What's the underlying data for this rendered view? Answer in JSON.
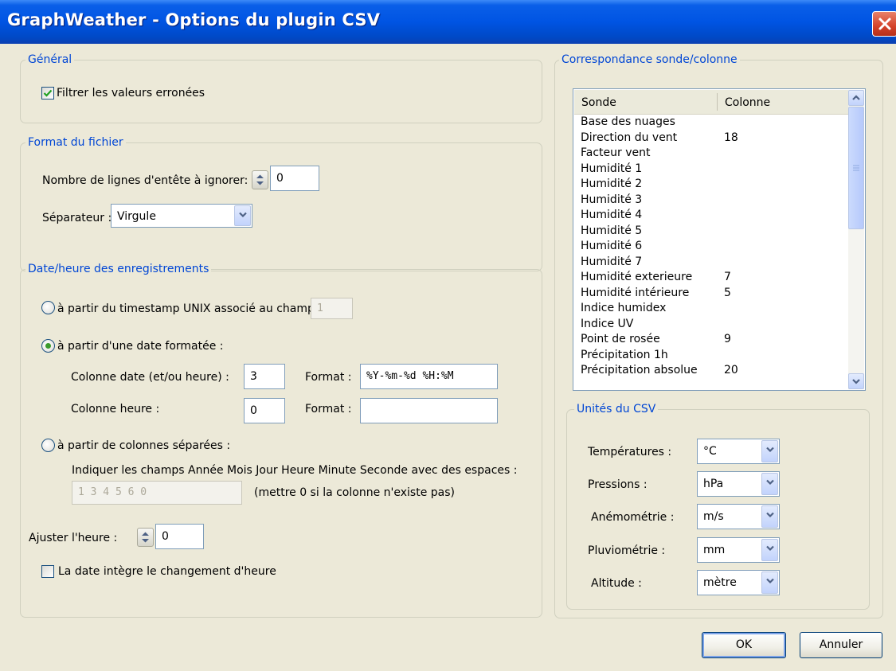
{
  "window": {
    "title": "GraphWeather - Options du plugin CSV"
  },
  "general": {
    "legend": "Général",
    "filter_label": "Filtrer les valeurs erronées",
    "filter_checked": true
  },
  "format": {
    "legend": "Format du fichier",
    "header_lines_label": "Nombre de lignes d'entête à ignorer:",
    "header_lines_value": "0",
    "separator_label": "Séparateur :",
    "separator_value": "Virgule"
  },
  "datetime": {
    "legend": "Date/heure des enregistrements",
    "option_unix_label": "à partir du timestamp UNIX associé au champ :",
    "option_unix_value": "1",
    "option_formatted_label": "à partir d'une date formatée :",
    "date_column_label": "Colonne date (et/ou heure) :",
    "date_column_value": "3",
    "format_label": "Format :",
    "date_format_value": "%Y-%m-%d %H:%M",
    "time_column_label": "Colonne heure :",
    "time_column_value": "0",
    "time_format_label": "Format :",
    "time_format_value": "",
    "option_separate_label": "à partir de colonnes séparées :",
    "separate_hint": "Indiquer les champs Année Mois Jour Heure Minute Seconde avec des espaces :",
    "separate_value": "1 3 4 5 6 0",
    "separate_note": "(mettre 0 si la colonne n'existe pas)",
    "selected_option": "formatted",
    "adjust_label": "Ajuster l'heure :",
    "adjust_value": "0",
    "dst_label": "La date intègre le changement d'heure",
    "dst_checked": false
  },
  "mapping": {
    "legend": "Correspondance sonde/colonne",
    "col_sensor": "Sonde",
    "col_column": "Colonne",
    "rows": [
      {
        "sensor": "Base des nuages",
        "column": ""
      },
      {
        "sensor": "Direction du vent",
        "column": "18"
      },
      {
        "sensor": "Facteur vent",
        "column": ""
      },
      {
        "sensor": "Humidité 1",
        "column": ""
      },
      {
        "sensor": "Humidité 2",
        "column": ""
      },
      {
        "sensor": "Humidité 3",
        "column": ""
      },
      {
        "sensor": "Humidité 4",
        "column": ""
      },
      {
        "sensor": "Humidité 5",
        "column": ""
      },
      {
        "sensor": "Humidité 6",
        "column": ""
      },
      {
        "sensor": "Humidité 7",
        "column": ""
      },
      {
        "sensor": "Humidité exterieure",
        "column": "7"
      },
      {
        "sensor": "Humidité intérieure",
        "column": "5"
      },
      {
        "sensor": "Indice humidex",
        "column": ""
      },
      {
        "sensor": "Indice UV",
        "column": ""
      },
      {
        "sensor": "Point de rosée",
        "column": "9"
      },
      {
        "sensor": "Précipitation 1h",
        "column": ""
      },
      {
        "sensor": "Précipitation absolue",
        "column": "20"
      }
    ]
  },
  "units": {
    "legend": "Unités du CSV",
    "items": [
      {
        "label": "Températures :",
        "value": "°C"
      },
      {
        "label": "Pressions :",
        "value": "hPa"
      },
      {
        "label": "Anémométrie :",
        "value": "m/s"
      },
      {
        "label": "Pluviométrie :",
        "value": "mm"
      },
      {
        "label": "Altitude :",
        "value": "mètre"
      }
    ]
  },
  "buttons": {
    "ok": "OK",
    "cancel": "Annuler"
  }
}
